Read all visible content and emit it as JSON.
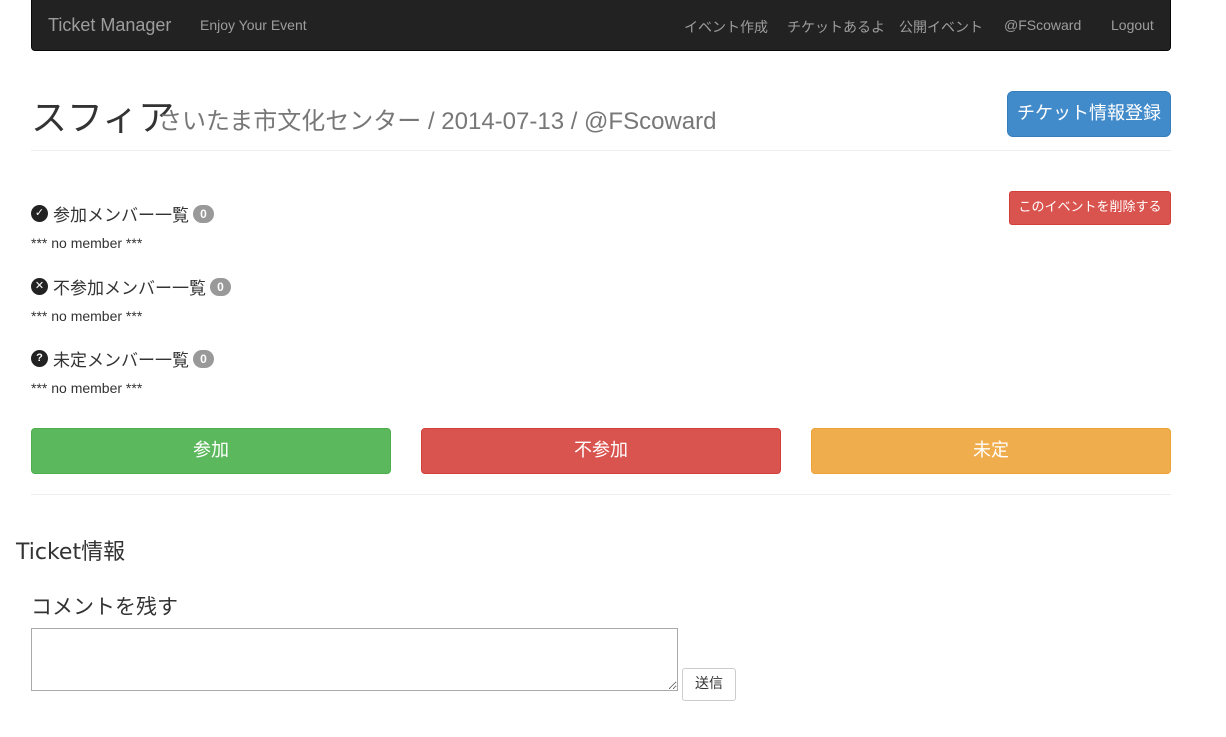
{
  "navbar": {
    "brand": "Ticket Manager",
    "tagline": "Enjoy Your Event",
    "links": [
      "イベント作成",
      "チケットあるよ",
      "公開イベント",
      "@FScoward",
      "Logout"
    ]
  },
  "header": {
    "title": "スフィア",
    "subtitle": "さいたま市文化センター / 2014-07-13 / @FScoward",
    "register_button": "チケット情報登録"
  },
  "delete_button": "このイベントを削除する",
  "sections": [
    {
      "icon": "check-circle-icon",
      "label": "参加メンバー一覧",
      "count": "0",
      "empty": "*** no member ***"
    },
    {
      "icon": "remove-circle-icon",
      "label": "不参加メンバー一覧",
      "count": "0",
      "empty": "*** no member ***"
    },
    {
      "icon": "question-circle-icon",
      "label": "未定メンバー一覧",
      "count": "0",
      "empty": "*** no member ***"
    }
  ],
  "actions": {
    "join": "参加",
    "decline": "不参加",
    "undecided": "未定"
  },
  "ticket_info_heading": "Ticket情報",
  "comment": {
    "heading": "コメントを残す",
    "value": "",
    "send_button": "送信"
  },
  "colors": {
    "navbar_bg": "#222222",
    "primary": "#428bca",
    "success": "#5cb85c",
    "danger": "#d9534f",
    "warning": "#f0ad4e",
    "badge": "#999999"
  }
}
